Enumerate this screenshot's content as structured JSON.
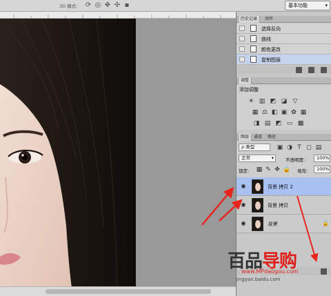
{
  "toolbar": {
    "mode_3d_label": "3D 模式:",
    "icons": [
      "rotate-3d-icon",
      "roll-3d-icon",
      "drag-3d-icon",
      "slide-3d-icon",
      "scale-3d-icon"
    ],
    "workspace_label": "基本功能"
  },
  "history": {
    "tabs": [
      "历史记录",
      "动作"
    ],
    "items": [
      {
        "label": "选择反向",
        "selected": false
      },
      {
        "label": "曲线",
        "selected": false
      },
      {
        "label": "颜色更改",
        "selected": false
      },
      {
        "label": "复制图层",
        "selected": true
      }
    ]
  },
  "adjustments": {
    "tabs": [
      "调整"
    ],
    "title": "添加调整"
  },
  "layers": {
    "tabs": [
      "图层",
      "通道",
      "路径"
    ],
    "kind_filter": "ρ 类型",
    "blend_mode": "正常",
    "opacity_label": "不透明度:",
    "opacity_value": "100%",
    "lock_label": "锁定:",
    "fill_label": "填充:",
    "fill_value": "100%",
    "rows": [
      {
        "name": "背景 拷贝 2",
        "selected": true,
        "locked": false
      },
      {
        "name": "背景 拷贝",
        "selected": false,
        "locked": false
      },
      {
        "name": "背景",
        "selected": false,
        "locked": true
      }
    ]
  },
  "annotations": {
    "arrow_color": "#e8231c"
  },
  "watermark": {
    "logo_part1": "百品",
    "logo_part2": "导购",
    "url": "www.MPdaogou.com",
    "source": "jingyan.baidu.com"
  }
}
